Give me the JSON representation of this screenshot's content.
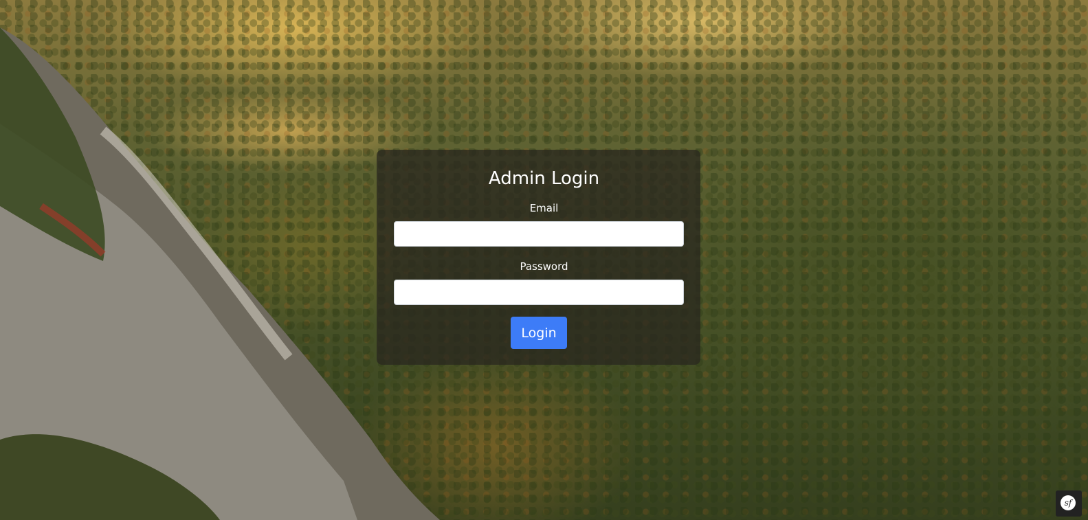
{
  "login": {
    "title": "Admin Login",
    "email_label": "Email",
    "email_value": "",
    "password_label": "Password",
    "password_value": "",
    "submit_label": "Login"
  },
  "debug_toolbar": {
    "icon": "symfony-logo-icon",
    "logo_text": "sf"
  },
  "colors": {
    "primary": "#3d7cf7",
    "panel": "rgba(40,38,30,0.72)",
    "text": "#ffffff"
  }
}
